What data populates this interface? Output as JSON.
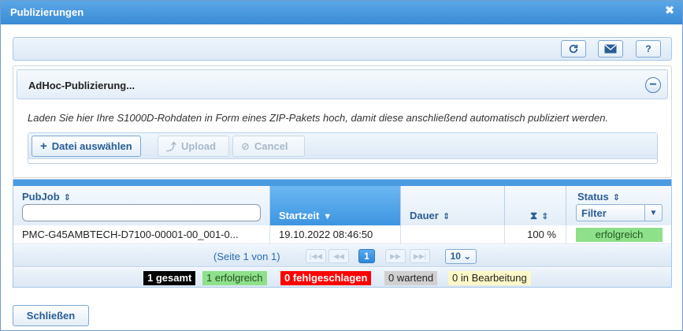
{
  "window": {
    "title": "Publizierungen",
    "close_glyph": "✖"
  },
  "toolbar": {
    "buttons": [
      {
        "name": "refresh",
        "icon": "refresh-icon",
        "glyph": "⟳"
      },
      {
        "name": "email",
        "icon": "envelope-icon",
        "glyph": "✉"
      },
      {
        "name": "help",
        "icon": "help-icon",
        "glyph": "?"
      }
    ]
  },
  "adhoc": {
    "title": "AdHoc-Publizierung...",
    "collapse_glyph": "−",
    "hint": "Laden Sie hier Ihre S1000D-Rohdaten in Form eines ZIP-Pakets hoch, damit diese anschließend automatisch publiziert werden.",
    "select_file_label": "Datei auswählen",
    "select_file_glyph": "+",
    "upload_label": "Upload",
    "upload_glyph": "⤴",
    "cancel_label": "Cancel",
    "cancel_glyph": "⊘"
  },
  "grid": {
    "columns": {
      "pubjob": "PubJob",
      "startzeit": "Startzeit",
      "dauer": "Dauer",
      "progress_icon": "hourglass-icon",
      "status": "Status"
    },
    "status_filter": "Filter",
    "sort_glyph": "⇕",
    "sort_desc_glyph": "▼",
    "hourglass_glyph": "⧗",
    "rows": [
      {
        "pubjob": "PMC-G45AMBTECH-D7100-00001-00_001-0...",
        "startzeit": "19.10.2022 08:46:50",
        "dauer": "",
        "progress": "100 %",
        "status": "erfolgreich"
      }
    ],
    "pager": {
      "info": "(Seite 1 von 1)",
      "current_page": "1",
      "per_page": "10 ⌄"
    },
    "summary": {
      "gesamt": "1 gesamt",
      "erfolgreich": "1 erfolgreich",
      "fehlgeschlagen": "0 fehlgeschlagen",
      "wartend": "0 wartend",
      "in_bearbeitung": "0 in Bearbeitung"
    }
  },
  "footer": {
    "close_label": "Schließen"
  },
  "colors": {
    "accent": "#3a8bd6",
    "success": "#8fe08a",
    "error": "#ff0000",
    "total": "#000000",
    "waiting": "#d0d0d0",
    "in_progress": "#fff8c8"
  }
}
